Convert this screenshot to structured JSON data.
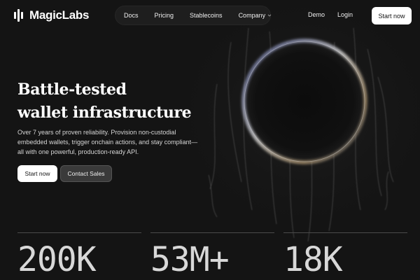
{
  "header": {
    "logo_text": "MagicLabs",
    "nav": [
      {
        "label": "Docs"
      },
      {
        "label": "Pricing"
      },
      {
        "label": "Stablecoins"
      },
      {
        "label": "Company",
        "icon": "chevron-down-icon"
      }
    ],
    "demo_label": "Demo",
    "login_label": "Login",
    "start_label": "Start now"
  },
  "hero": {
    "title_line1": "Battle-tested",
    "title_line2": "wallet infrastructure",
    "description": "Over 7 years of proven reliability. Provision non-custodial embedded wallets, trigger onchain actions, and stay compliant—all with one powerful, production-ready API.",
    "primary_cta": "Start now",
    "secondary_cta": "Contact Sales"
  },
  "stats": [
    {
      "value": "200K"
    },
    {
      "value": "53M+"
    },
    {
      "value": "18K"
    }
  ],
  "colors": {
    "background": "#141414",
    "button_primary": "#ffffff",
    "button_secondary": "#3a3a3a"
  }
}
